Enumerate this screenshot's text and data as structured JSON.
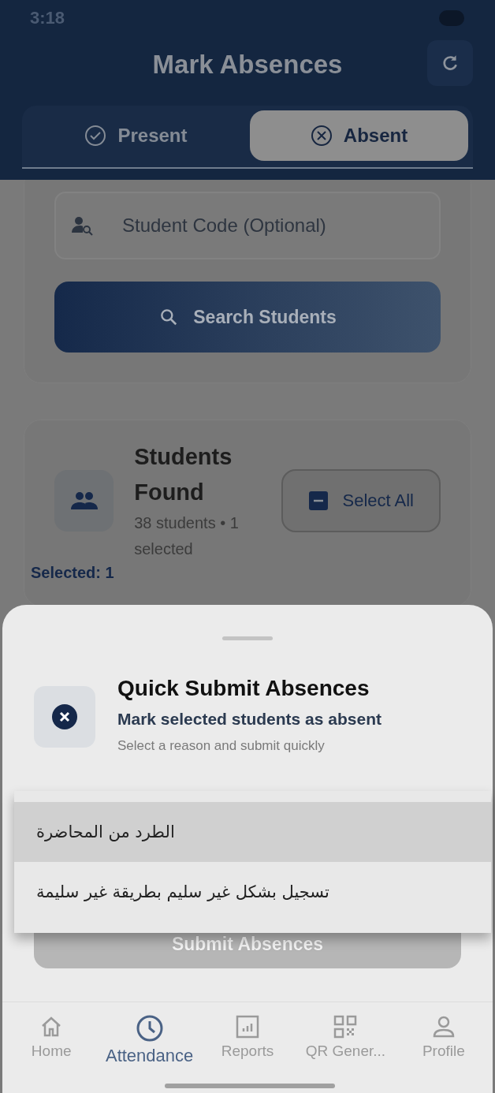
{
  "status_bar": {
    "time": "3:18"
  },
  "header": {
    "title": "Mark Absences"
  },
  "tabs": [
    {
      "label": "Present",
      "selected": false
    },
    {
      "label": "Absent",
      "selected": true
    }
  ],
  "search": {
    "placeholder": "Student Code (Optional)",
    "button": "Search Students"
  },
  "students": {
    "title": "Students Found",
    "summary": "38 students • 1 selected",
    "select_all": "Select All",
    "selected_count": "Selected: 1"
  },
  "sheet": {
    "title": "Quick Submit Absences",
    "subtitle": "Mark selected students as absent",
    "hint": "Select a reason and submit quickly",
    "submit": "Submit Absences",
    "submit_disabled": true
  },
  "reason_menu": [
    {
      "label": "الطرد من المحاضرة",
      "selected": true
    },
    {
      "label": "تسجيل بشكل غير سليم بطريقة غير سليمة",
      "selected": false
    }
  ],
  "nav": [
    {
      "label": "Home",
      "selected": false
    },
    {
      "label": "Attendance",
      "selected": true
    },
    {
      "label": "Reports",
      "selected": false
    },
    {
      "label": "QR Gener...",
      "selected": false
    },
    {
      "label": "Profile",
      "selected": false
    }
  ]
}
